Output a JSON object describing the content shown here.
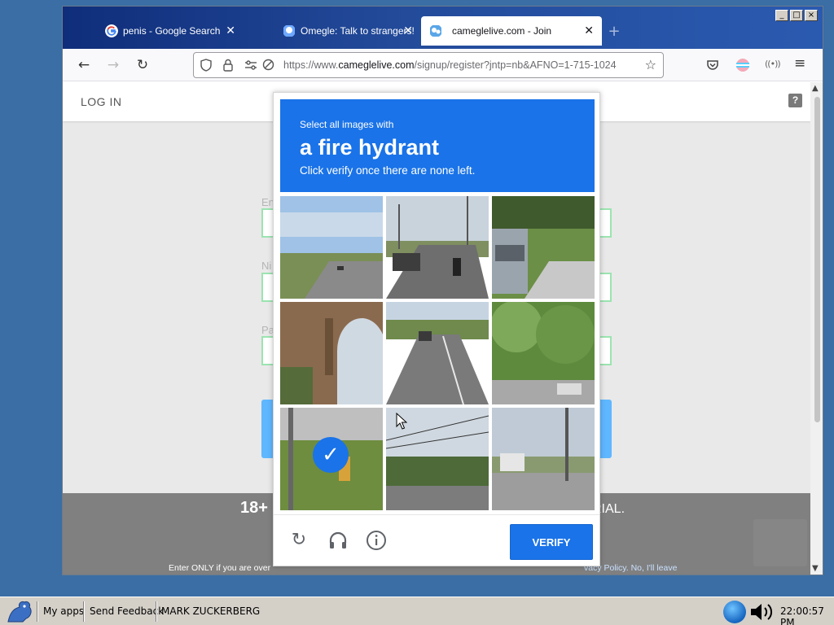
{
  "window": {
    "controls": [
      "_",
      "□",
      "×"
    ]
  },
  "tabs": [
    {
      "title": "penis - Google Search",
      "icon": "google-icon",
      "active": false
    },
    {
      "title": "Omegle: Talk to strangers!",
      "icon": "omegle-icon",
      "active": false
    },
    {
      "title": "cameglelive.com - Join",
      "icon": "cameglelive-icon",
      "active": true
    }
  ],
  "new_tab": "+",
  "address": {
    "prefix": "https://www.",
    "domain": "cameglelive.com",
    "rest": "/signup/register?jntp=nb&AFNO=1-715-1024"
  },
  "page": {
    "login": "LOG IN",
    "help": "?",
    "label1": "En",
    "label2": "Ni",
    "label3": "Pa",
    "age_text": "18+",
    "terial": "RIAL.",
    "enter_only": "Enter ONLY if you are over",
    "privacy": "vacy Policy. No, I'll leave"
  },
  "captcha": {
    "instruction_small": "Select all images with",
    "instruction_big": "a fire hydrant",
    "instruction_sub": "Click verify once there are none left.",
    "verify_label": "VERIFY",
    "check": "✓",
    "selected_cell": 6
  },
  "taskbar": {
    "my_apps": "My apps",
    "send_feedback": "Send Feedback",
    "user": "MARK ZUCKERBERG",
    "clock": "22:00:57 PM"
  },
  "colors": {
    "captcha_blue": "#1a73e8",
    "desktop": "#3a6ea5",
    "titlebar": "#234b9a",
    "taskbar": "#d4d0c8"
  }
}
